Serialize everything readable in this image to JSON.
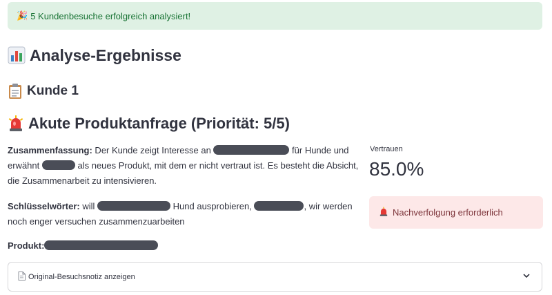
{
  "banner": {
    "icon": "party-popper-icon",
    "text": "5 Kundenbesuche erfolgreich analysiert!"
  },
  "results": {
    "icon": "bar-chart-icon",
    "title": "Analyse-Ergebnisse"
  },
  "customer": {
    "icon": "clipboard-icon",
    "title": "Kunde 1"
  },
  "inquiry": {
    "icon": "siren-icon",
    "title": "Akute Produktanfrage (Priorität: 5/5)"
  },
  "summary": {
    "label": "Zusammenfassung:",
    "part1": " Der Kunde zeigt Interesse an ",
    "part2": " für Hunde und erwähnt ",
    "part3": " als neues Produkt, mit dem er nicht vertraut ist. Es besteht die Absicht, die Zusammenarbeit zu intensivieren."
  },
  "keywords": {
    "label": "Schlüsselwörter:",
    "part1": " will ",
    "part2": " Hund ausprobieren, ",
    "part3": ", wir werden noch enger versuchen zusammenzuarbeiten"
  },
  "product": {
    "label": "Produkt:"
  },
  "confidence": {
    "label": "Vertrauen",
    "value": "85.0%"
  },
  "followup": {
    "icon": "siren-icon",
    "text": "Nachverfolgung erforderlich"
  },
  "expander": {
    "icon": "document-icon",
    "label": "Original-Besuchsnotiz anzeigen",
    "chevron": "chevron-down-icon"
  },
  "colors": {
    "success_bg": "#dff1e4",
    "success_text": "#177233",
    "error_bg": "#fde8e8",
    "error_text": "#7d353b",
    "redaction": "#4a4d57"
  }
}
